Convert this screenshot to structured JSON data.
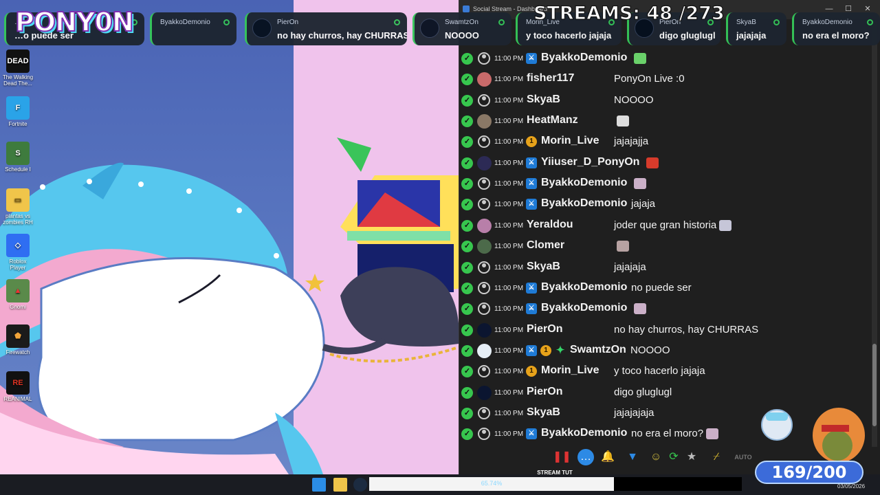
{
  "logo": {
    "text": "PONY0N"
  },
  "streams": {
    "label": "STREAMS: 48 /273"
  },
  "bubbles": [
    {
      "name": "…onio",
      "message": "…o puede ser"
    },
    {
      "name": "ByakkoDemonio",
      "message": ""
    },
    {
      "name": "PierOn",
      "message": "no hay churros, hay CHURRAS"
    },
    {
      "name": "SwamtzOn",
      "message": "NOOOO"
    },
    {
      "name": "Morin_Live",
      "message": "y toco hacerlo jajaja"
    },
    {
      "name": "PierOn",
      "message": "digo gluglugl"
    },
    {
      "name": "SkyaB",
      "message": "jajajaja"
    },
    {
      "name": "ByakkoDemonio",
      "message": "no era el moro?"
    }
  ],
  "desktop_icons": [
    {
      "label": "The Walking Dead The...",
      "icon": "walking-dead-icon"
    },
    {
      "label": "Fortnite",
      "icon": "fortnite-icon"
    },
    {
      "label": "Schedule I",
      "icon": "schedule-icon"
    },
    {
      "label": "plantas vs zombies RH",
      "icon": "folder-icon"
    },
    {
      "label": "Roblox Player",
      "icon": "roblox-icon"
    },
    {
      "label": "Gnomi",
      "icon": "gnome-icon"
    },
    {
      "label": "Firewatch",
      "icon": "firewatch-icon"
    },
    {
      "label": "REANIMAL",
      "icon": "reanimal-icon"
    }
  ],
  "chat_window": {
    "title": "Social Stream - Dashboard",
    "messages": [
      {
        "time": "11:00 PM",
        "user": "ByakkoDemonio",
        "message": "",
        "badges": [
          "mod"
        ],
        "emote": "#6ad16a"
      },
      {
        "time": "11:00 PM",
        "user": "fisher117",
        "message": "PonyOn Live :0",
        "badges": [],
        "avatar": "#c96a6a"
      },
      {
        "time": "11:00 PM",
        "user": "SkyaB",
        "message": "NOOOO",
        "badges": []
      },
      {
        "time": "11:00 PM",
        "user": "HeatManz",
        "message": "",
        "badges": [],
        "avatar": "#8a7866",
        "emote": "#dddddd"
      },
      {
        "time": "11:00 PM",
        "user": "Morin_Live",
        "message": "jajajajja",
        "badges": [
          "sub"
        ]
      },
      {
        "time": "11:00 PM",
        "user": "Yiiuser_D_PonyOn",
        "message": "",
        "badges": [
          "mod"
        ],
        "avatar": "#2c2a55",
        "emote": "#d63b2b"
      },
      {
        "time": "11:00 PM",
        "user": "ByakkoDemonio",
        "message": "",
        "badges": [
          "mod"
        ],
        "emote": "#cbb0c8"
      },
      {
        "time": "11:00 PM",
        "user": "ByakkoDemonio",
        "message": "jajaja",
        "badges": [
          "mod"
        ]
      },
      {
        "time": "11:00 PM",
        "user": "Yeraldou",
        "message": "joder que gran historia",
        "badges": [],
        "avatar": "#b87fa9",
        "emote": "#c6c6d8"
      },
      {
        "time": "11:00 PM",
        "user": "Clomer",
        "message": "",
        "badges": [],
        "avatar": "#4c6a4a",
        "emote": "#b7a2a2"
      },
      {
        "time": "11:00 PM",
        "user": "SkyaB",
        "message": "jajajaja",
        "badges": []
      },
      {
        "time": "11:00 PM",
        "user": "ByakkoDemonio",
        "message": "no puede ser",
        "badges": [
          "mod"
        ]
      },
      {
        "time": "11:00 PM",
        "user": "ByakkoDemonio",
        "message": "",
        "badges": [
          "mod"
        ],
        "emote": "#cbb0c8"
      },
      {
        "time": "11:00 PM",
        "user": "PierOn",
        "message": "no hay churros, hay CHURRAS",
        "badges": [],
        "avatar": "#0b1530"
      },
      {
        "time": "11:00 PM",
        "user": "SwamtzOn",
        "message": "NOOOO",
        "badges": [
          "mod",
          "sub",
          "vip"
        ],
        "avatar": "#e6eef6"
      },
      {
        "time": "11:00 PM",
        "user": "Morin_Live",
        "message": "y toco hacerlo jajaja",
        "badges": [
          "sub"
        ]
      },
      {
        "time": "11:00 PM",
        "user": "PierOn",
        "message": "digo gluglugl",
        "badges": [],
        "avatar": "#0b1530"
      },
      {
        "time": "11:00 PM",
        "user": "SkyaB",
        "message": "jajajajaja",
        "badges": []
      },
      {
        "time": "11:00 PM",
        "user": "ByakkoDemonio",
        "message": "no era el moro?",
        "badges": [
          "mod"
        ],
        "emote": "#cbb0c8"
      }
    ]
  },
  "toolbar": {
    "auto_label": "AUTO"
  },
  "progress": {
    "title": "STREAM TUT",
    "percent_label": "65.74%",
    "fraction": 0.6574
  },
  "goal": {
    "label": "169/200"
  },
  "clock": {
    "date": "03/05/2026"
  }
}
